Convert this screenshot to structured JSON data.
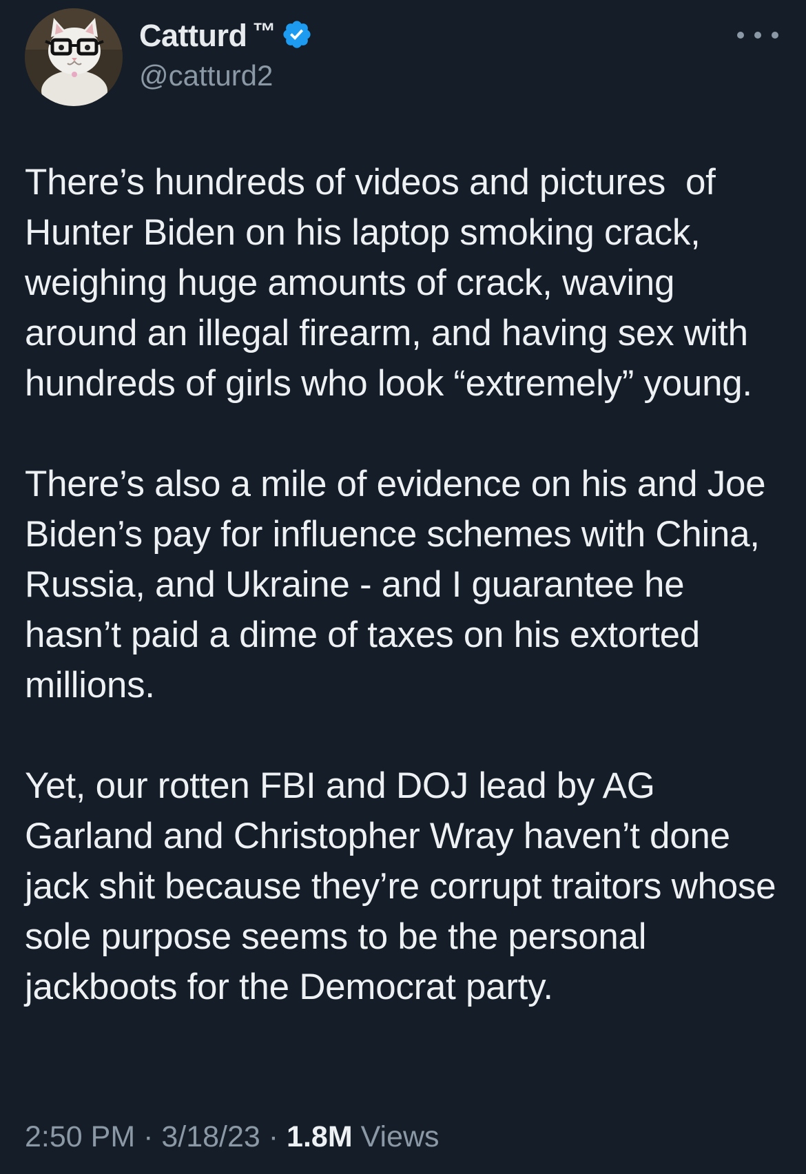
{
  "author": {
    "display_name": "Catturd",
    "trademark": "™",
    "handle": "@catturd2",
    "verified": true,
    "avatar": "cat-with-glasses-avatar"
  },
  "tweet": {
    "paragraphs": [
      "There’s hundreds of videos and pictures  of Hunter Biden on his laptop smoking crack, weighing huge amounts of crack, waving around an illegal firearm, and having sex with hundreds of girls who look “extremely” young.",
      "There’s also a mile of evidence on his and Joe Biden’s pay for influence schemes with China, Russia, and Ukraine - and I guarantee he hasn’t paid a dime of taxes on his extorted millions.",
      "Yet, our rotten FBI and DOJ lead by AG Garland and Christopher Wray haven’t done jack shit because they’re corrupt traitors whose sole purpose seems to be the personal jackboots for the Democrat party."
    ]
  },
  "meta": {
    "time": "2:50 PM",
    "date": "3/18/23",
    "separator": " · ",
    "views_count": "1.8M",
    "views_label": "Views"
  },
  "colors": {
    "background": "#151d28",
    "text_primary": "#eef1f3",
    "text_secondary": "#8b98a5",
    "verified_badge": "#1d9bf0"
  },
  "icons": {
    "verified": "verified-badge-icon",
    "more": "more-options-icon"
  }
}
